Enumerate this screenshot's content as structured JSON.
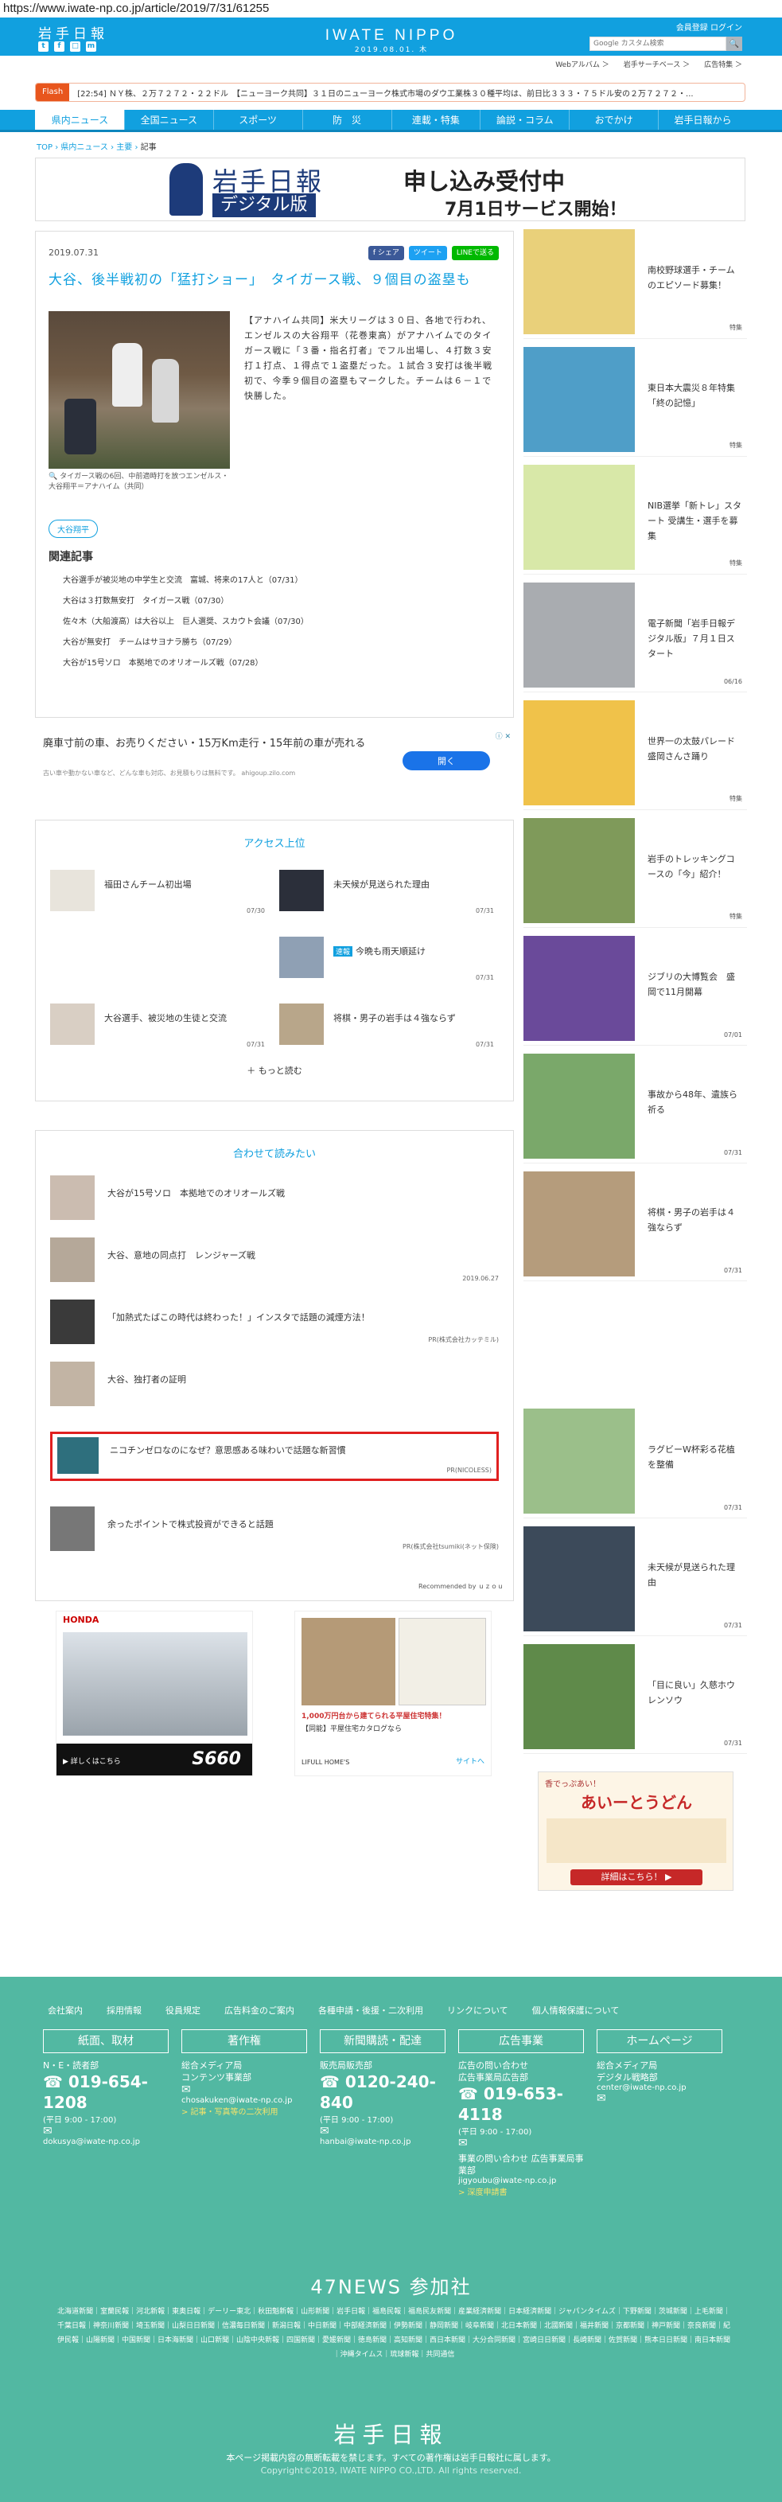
{
  "url": "https://www.iwate-np.co.jp/article/2019/7/31/61255",
  "header": {
    "logo_text": "岩手日報",
    "brand": "IWATE NIPPO",
    "date": "2019.08.01. 木",
    "member_links": "会員登録 ログイン",
    "search_placeholder": "Google カスタム検索",
    "search_button": "🔍",
    "social": [
      "t",
      "f",
      "□",
      "m"
    ]
  },
  "sublinks": [
    "Webアルバム ＞",
    "岩手サーチベース ＞",
    "広告特集 ＞"
  ],
  "flash": {
    "label": "Flash",
    "text": "[22:54] ＮＹ株、２万７２７２・２２ドル　【ニューヨーク共同】３１日のニューヨーク株式市場のダウ工業株３０種平均は、前日比３３３・７５ドル安の２万７２７２・..."
  },
  "nav": [
    "県内ニュース",
    "全国ニュース",
    "スポーツ",
    "防　災",
    "連載・特集",
    "論説・コラム",
    "おでかけ",
    "岩手日報から"
  ],
  "breadcrumb": {
    "top": "TOP",
    "sep": "›",
    "local": "県内ニュース",
    "main": "主要",
    "current": "記事"
  },
  "banner": {
    "logo": "岩手日報",
    "digital": "デジタル版",
    "main": "申し込み受付中",
    "sub": "7月1日サービス開始！"
  },
  "article": {
    "date": "2019.07.31",
    "share": {
      "fb": "f シェア",
      "tw": "ツイート",
      "line": "LINEで送る"
    },
    "title": "大谷、後半戦初の「猛打ショー」　タイガース戦、９個目の盗塁も",
    "caption": "🔍 タイガース戦の6回、中前適時打を放つエンゼルス・大谷翔平＝アナハイム（共同）",
    "body": "【アナハイム共同】米大リーグは３０日、各地で行われ、エンゼルスの大谷翔平（花巻東高）がアナハイムでのタイガース戦に「３番・指名打者」でフル出場し、４打数３安打１打点、１得点で１盗塁だった。１試合３安打は後半戦初で、今季９個目の盗塁もマークした。チームは６－１で快勝した。",
    "tag": "大谷翔平",
    "related_title": "関連記事",
    "related": [
      "大谷選手が被災地の中学生と交流　富城、将来の17人と（07/31）",
      "大谷は３打数無安打　タイガース戦（07/30）",
      "佐々木（大船渡高）は大谷以上　巨人選奨、スカウト会議（07/30）",
      "大谷が無安打　チームはサヨナラ勝ち（07/29）",
      "大谷が15号ソロ　本拠地でのオリオールズ戦（07/28）"
    ]
  },
  "ad_text": {
    "text": "廃車寸前の車、お売りください・15万Km走行・15年前の車が売れる",
    "sub": "古い車や動かない車など、どんな車も対応、お見積もりは無料です。 ahigoup.zilo.com",
    "button": "開く",
    "mark": "ⓘ ✕"
  },
  "access": {
    "title": "アクセス上位",
    "items": [
      {
        "title": "福田さんチーム初出場",
        "date": "07/30"
      },
      {
        "title": "未天候が見送られた理由",
        "date": "07/31"
      },
      {
        "badge": "速報",
        "title": "今晩も雨天順延け",
        "date": "07/31"
      },
      {
        "title": "大谷選手、被災地の生徒と交流",
        "date": "07/31"
      },
      {
        "title": "将棋・男子の岩手は４強ならず",
        "date": "07/31"
      }
    ],
    "more": "＋ もっと読む"
  },
  "recommend": {
    "title": "合わせて読みたい",
    "items": [
      {
        "title": "大谷が15号ソロ　本拠地でのオリオールズ戦",
        "meta": ""
      },
      {
        "title": "大谷、意地の同点打　レンジャーズ戦",
        "meta": "2019.06.27"
      },
      {
        "title": "「加熱式たばこの時代は終わった！」インスタで話題の減煙方法！",
        "meta": "PR(株式会社カッテミル)"
      },
      {
        "title": "大谷、独打者の証明",
        "meta": ""
      },
      {
        "title": "ニコチンゼロなのになぜ？意思感ある味わいで話題な新習慣",
        "meta": "PR(NICOLESS)"
      },
      {
        "title": "余ったポイントで株式投資ができると話題",
        "meta": "PR(株式会社tsumiki(ネット保険)"
      }
    ],
    "powered": "Recommended by ｕｚｏｕ"
  },
  "sidebar": [
    {
      "title": "南校野球選手・チームのエピソード募集！",
      "date": "特集"
    },
    {
      "title": "東日本大震災８年特集「終の記憶」",
      "date": "特集"
    },
    {
      "title": "NIB選挙「新トレ」スタート 受講生・選手を募集",
      "date": "特集"
    },
    {
      "title": "電子新聞「岩手日報デジタル版」７月１日スタート",
      "date": "06/16"
    },
    {
      "title": "世界一の太鼓パレード　盛岡さんさ踊り",
      "date": "特集"
    },
    {
      "title": "岩手のトレッキングコースの「今」紹介！",
      "date": "特集"
    },
    {
      "title": "ジブリの大博覧会　盛岡で11月開幕",
      "date": "07/01"
    },
    {
      "title": "事故から48年、遺族ら祈る",
      "date": "07/31"
    },
    {
      "title": "将棋・男子の岩手は４強ならず",
      "date": "07/31"
    },
    {
      "title": "ラグビーW杯彩る花植を整備",
      "date": "07/31"
    },
    {
      "title": "未天候が見送られた理由",
      "date": "07/31"
    },
    {
      "title": "「目に良い」久慈ホウレンソウ",
      "date": "07/31"
    }
  ],
  "banner_ads": {
    "honda_brand": "HONDA",
    "honda_model": "S660",
    "honda_link": "▶ 詳しくはこちら",
    "house_text": "【同能】平屋住宅カタログなら",
    "house_price": "1,000万円台から建てられる平屋住宅特集！",
    "house_brand": "LIFULL HOME'S",
    "house_link": "サイトへ",
    "udon_head": "香でっぷあい！",
    "udon_main": "あいーとうどん",
    "udon_link": "詳細はこちら！ ▶"
  },
  "footer": {
    "links": [
      "会社案内",
      "採用情報",
      "役員規定",
      "広告料金のご案内",
      "各種申請・後援・二次利用",
      "リンクについて",
      "個人情報保護について"
    ],
    "cols": [
      {
        "head": "紙面、取材",
        "lines": [
          "N・E・読者部"
        ],
        "phone": "019-654-1208",
        "hours": "(平日 9:00 - 17:00)",
        "mail": "dokusya@iwate-np.co.jp",
        "link": ""
      },
      {
        "head": "著作権",
        "lines": [
          "総合メディア局",
          "コンテンツ事業部"
        ],
        "phone": "",
        "hours": "",
        "mail": "chosakuken@iwate-np.co.jp",
        "link": "> 記事・写真等の二次利用"
      },
      {
        "head": "新聞購読・配達",
        "lines": [
          "販売局販売部"
        ],
        "phone": "0120-240-840",
        "hours": "(平日 9:00 - 17:00)",
        "mail": "hanbai@iwate-np.co.jp",
        "link": ""
      },
      {
        "head": "広告事業",
        "lines": [
          "広告の問い合わせ",
          "広告事業局広告部"
        ],
        "phone": "019-653-4118",
        "hours": "(平日 9:00 - 17:00)",
        "mail": "jigyoubu@iwate-np.co.jp",
        "link": "> 深度申請書"
      },
      {
        "head": "ホームページ",
        "lines": [
          "総合メディア局",
          "デジタル戦略部"
        ],
        "phone": "",
        "hours": "",
        "mail": "center@iwate-np.co.jp",
        "link": ""
      }
    ],
    "jigyo_extra": "事業の問い合わせ 広告事業局事業部",
    "n47": "47NEWS 参加社",
    "papers": "北海道新聞｜室蘭民報｜河北新報｜東奥日報｜デーリー東北｜秋田魁新報｜山形新聞｜岩手日報｜福島民報｜福島民友新聞｜産業経済新聞｜日本経済新聞｜ジャパンタイムズ｜下野新聞｜茨城新聞｜上毛新聞｜千葉日報｜神奈川新聞｜埼玉新聞｜山梨日日新聞｜信濃毎日新聞｜新潟日報｜中日新聞｜中部経済新聞｜伊勢新聞｜静岡新聞｜岐阜新聞｜北日本新聞｜北國新聞｜福井新聞｜京都新聞｜神戸新聞｜奈良新聞｜紀伊民報｜山陽新聞｜中国新聞｜日本海新聞｜山口新聞｜山陰中央新報｜四国新聞｜愛媛新聞｜徳島新聞｜高知新聞｜西日本新聞｜大分合同新聞｜宮崎日日新聞｜長崎新聞｜佐賀新聞｜熊本日日新聞｜南日本新聞｜沖縄タイムス｜琉球新報｜共同通信",
    "logo": "岩手日報",
    "note": "本ページ掲載内容の無断転載を禁じます。すべての著作権は岩手日報社に属します。",
    "copyright": "Copyright©2019, IWATE NIPPO CO.,LTD. All rights reserved."
  }
}
